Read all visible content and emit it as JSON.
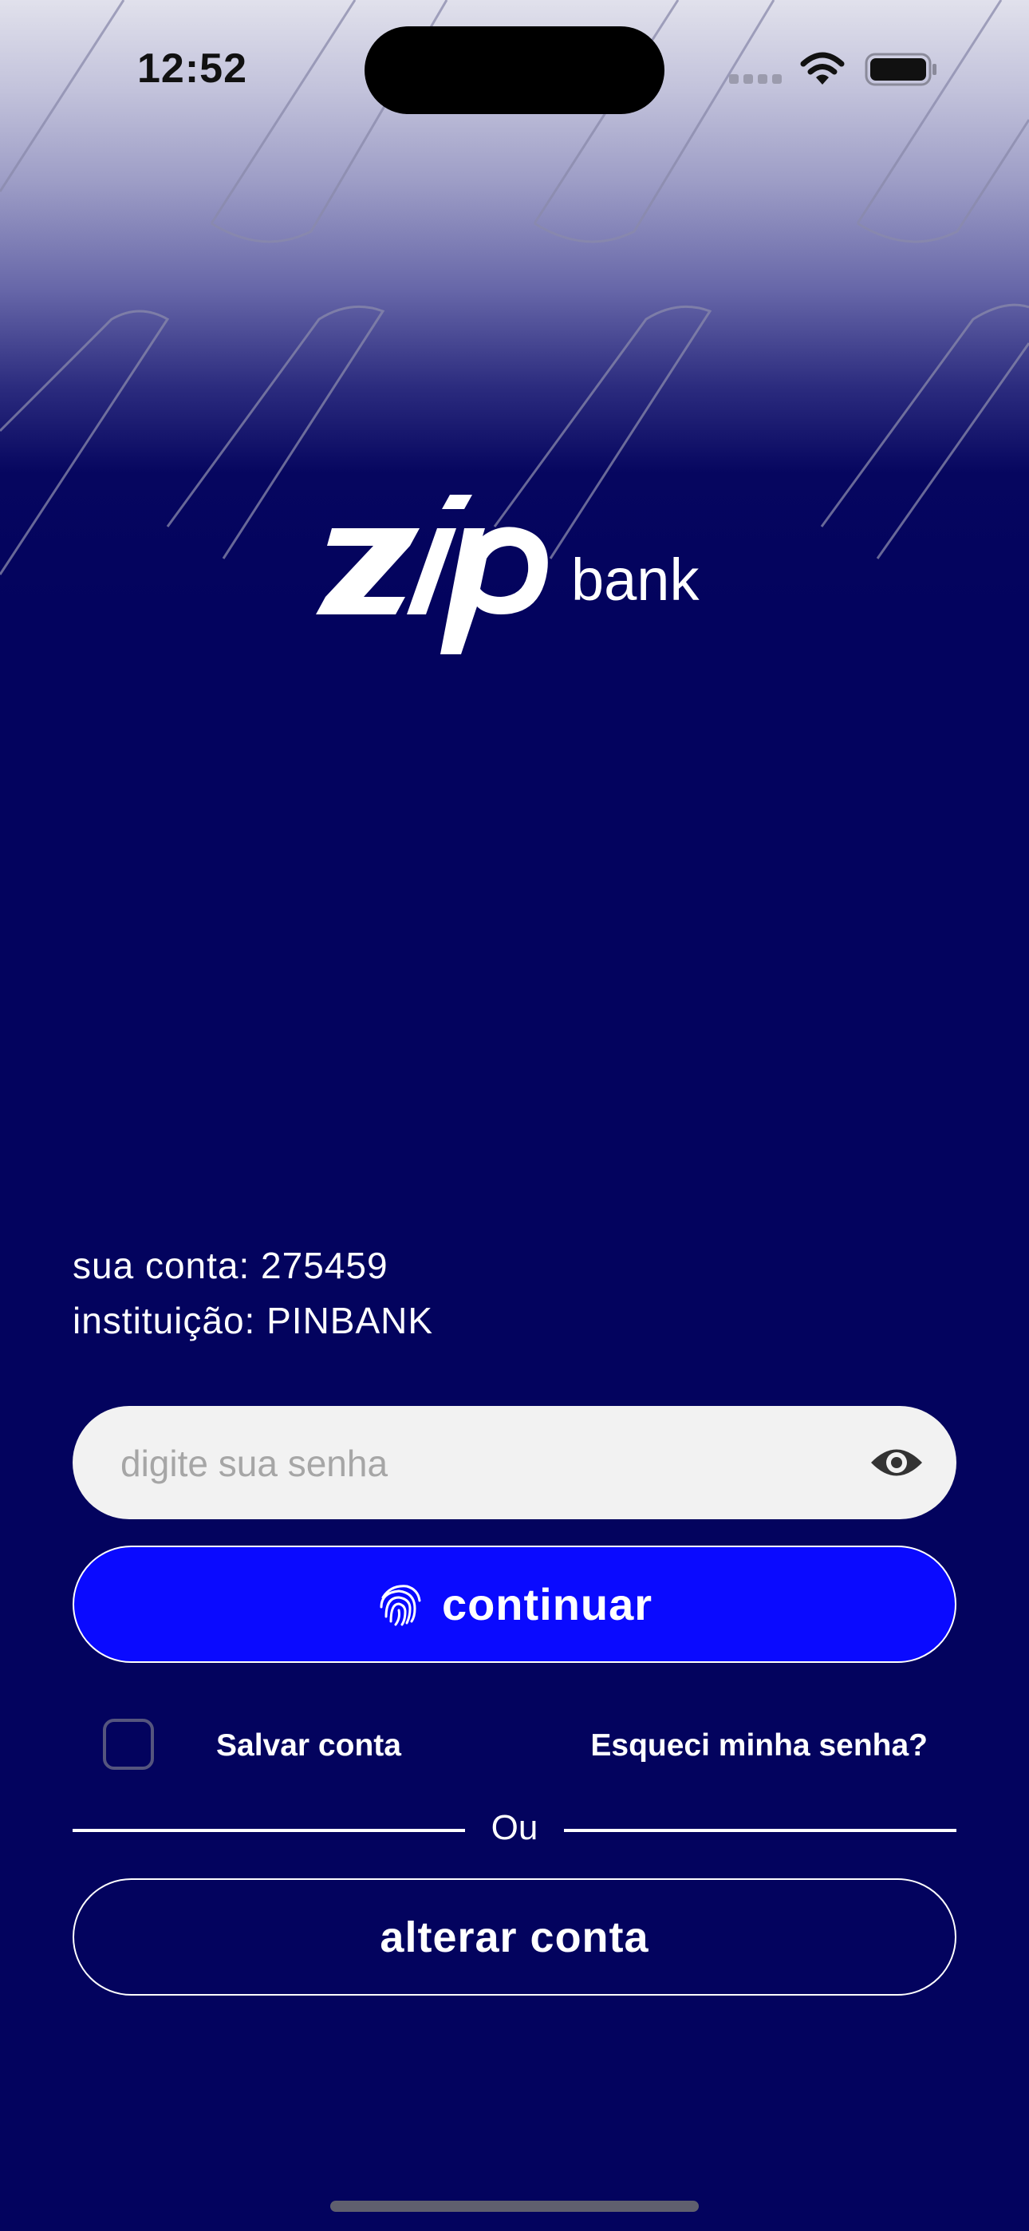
{
  "status_bar": {
    "time": "12:52",
    "icons": [
      "cellular-signal-icon",
      "wifi-icon",
      "battery-icon"
    ]
  },
  "logo": {
    "brand": "Zip",
    "suffix": "bank"
  },
  "account": {
    "account_line": "sua conta: 275459",
    "institution_line": "instituição: PINBANK"
  },
  "password_field": {
    "placeholder": "digite sua senha",
    "value": "",
    "toggle_icon": "eye-icon"
  },
  "continue_button": {
    "label": "continuar",
    "icon": "fingerprint-icon"
  },
  "options": {
    "save_account_label": "Salvar conta",
    "save_account_checked": false,
    "forgot_password_label": "Esqueci minha senha?"
  },
  "separator": {
    "label": "Ou"
  },
  "change_account_button": {
    "label": "alterar conta"
  },
  "colors": {
    "background": "#03035e",
    "primary_button": "#0a0aff",
    "input_background": "#f2f2f2",
    "text": "#ffffff"
  }
}
